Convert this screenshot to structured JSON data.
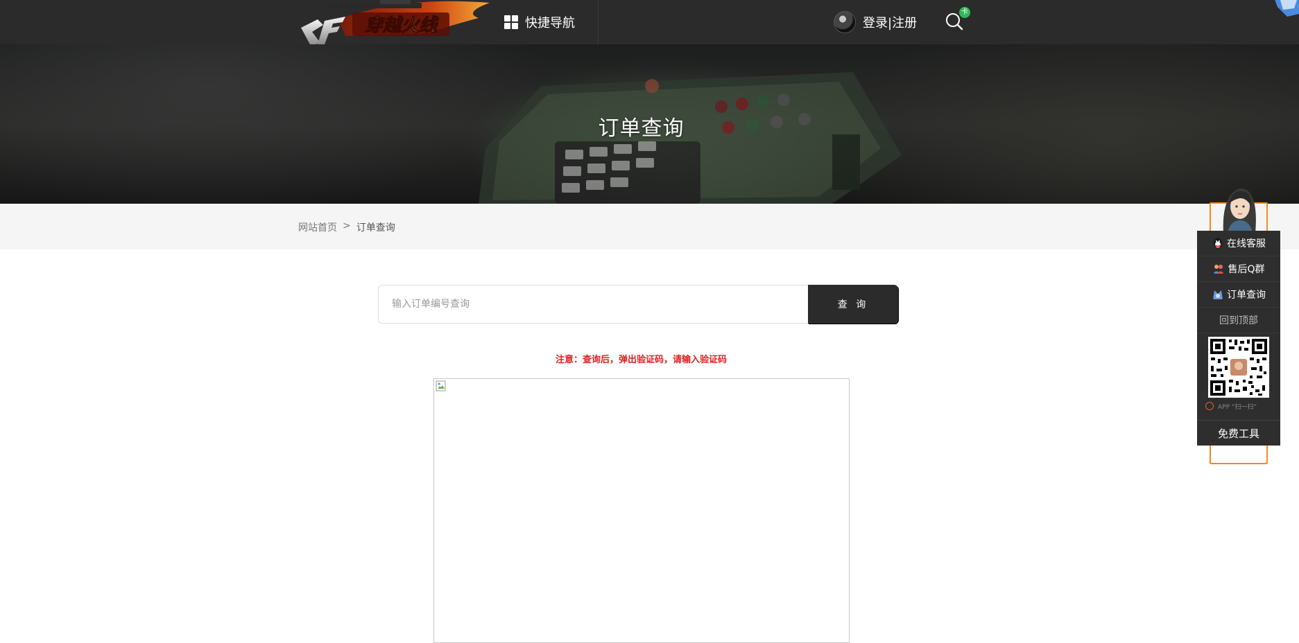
{
  "header": {
    "logo_text": "穿越火线",
    "quick_nav_label": "快捷导航",
    "login_label": "登录|注册",
    "search_badge": "卡"
  },
  "banner": {
    "title": "订单查询"
  },
  "breadcrumb": {
    "home": "网站首页",
    "separator": ">",
    "current": "订单查询"
  },
  "order_search": {
    "placeholder": "输入订单编号查询",
    "value": "",
    "button_label": "查 询",
    "notice": "注意：查询后，弹出验证码，请输入验证码"
  },
  "side_panel": {
    "items": [
      {
        "label": "在线客服",
        "icon": "qq-penguin-icon"
      },
      {
        "label": "售后Q群",
        "icon": "group-icon"
      },
      {
        "label": "订单查询",
        "icon": "order-icon"
      }
    ],
    "back_to_top": "回到顶部",
    "qr_caption": "APP “扫一扫”",
    "tools_label": "免费工具"
  },
  "colors": {
    "topbar": "#2b2b2b",
    "notice_red": "#e02020",
    "side_frame_orange": "#f28a1f",
    "badge_green": "#2fb85a"
  }
}
